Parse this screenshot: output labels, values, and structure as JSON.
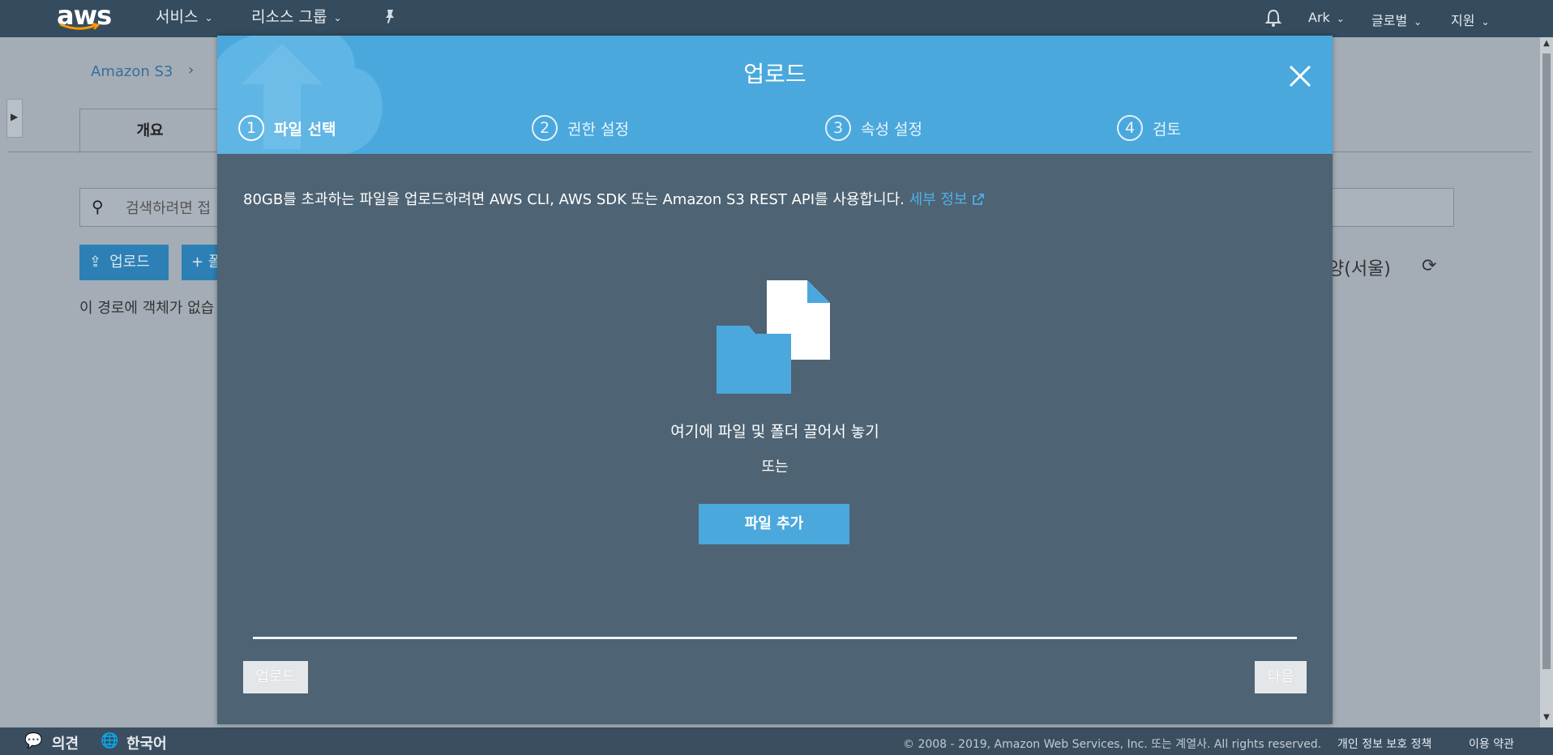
{
  "topnav": {
    "logo": "aws",
    "services_label": "서비스",
    "resource_groups_label": "리소스 그룹",
    "pin_icon": "pin-icon",
    "bell_icon": "bell-icon",
    "user_label": "Ark",
    "region_label": "글로벌",
    "support_label": "지원"
  },
  "background_page": {
    "breadcrumb_root": "Amazon S3",
    "breadcrumb_sep": "›",
    "tab_overview": "개요",
    "search_placeholder": "검색하려면 접",
    "upload_button": "업로드",
    "create_button_partial": "+ 폴",
    "empty_text": "이 경로에 객체가 없습",
    "region_text": "양(서울)"
  },
  "modal": {
    "title": "업로드",
    "close_icon": "close-icon",
    "steps": [
      {
        "num": "1",
        "label": "파일 선택"
      },
      {
        "num": "2",
        "label": "권한 설정"
      },
      {
        "num": "3",
        "label": "속성 설정"
      },
      {
        "num": "4",
        "label": "검토"
      }
    ],
    "info_text": "80GB를 초과하는 파일을 업로드하려면 AWS CLI, AWS SDK 또는 Amazon S3 REST API를 사용합니다.",
    "info_link": "세부 정보",
    "drop_text": "여기에 파일 및 폴더 끌어서 놓기",
    "or_text": "또는",
    "add_files_button": "파일 추가",
    "upload_button": "업로드",
    "next_button": "다음"
  },
  "footer": {
    "feedback": "의견",
    "language": "한국어",
    "copyright": "© 2008 - 2019, Amazon Web Services, Inc. 또는 계열사. All rights reserved.",
    "privacy": "개인 정보 보호 정책",
    "terms": "이용 약관"
  },
  "colors": {
    "accent": "#4aa8dd",
    "modal_bg": "#4e6373",
    "nav_bg": "#354c5e"
  }
}
